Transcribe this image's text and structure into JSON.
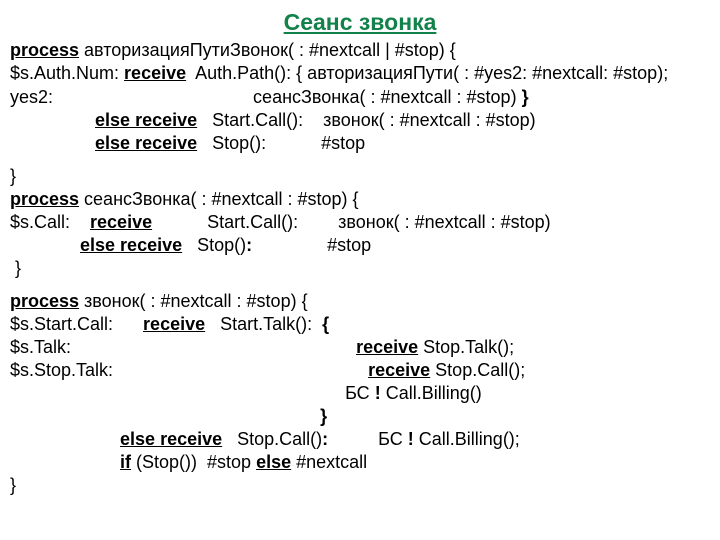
{
  "title": "Сеанс звонка",
  "block1": {
    "l1a": "process",
    "l1b": " авторизацияПутиЗвонок( : #nextcall | #stop) {",
    "l2a": "$s.Auth.Num: ",
    "l2b": "receive",
    "l2c": "  Auth.Path(): { авторизацияПути( : #yes2: #nextcall: #stop);",
    "l3": "yes2:                                        сеансЗвонка( : #nextcall : #stop) ",
    "l3b": "}",
    "l4a": "                 ",
    "l4b": "else receive",
    "l4c": "   Start.Call():    звонок( : #nextcall : #stop)",
    "l5a": "                 ",
    "l5b": "else receive",
    "l5c": "   Stop():           #stop",
    "l6": "}"
  },
  "block2": {
    "l1a": "process",
    "l1b": " сеансЗвонка( : #nextcall : #stop) {",
    "l2a": "$s.Call:    ",
    "l2b": "receive",
    "l2c": "           Start.Call():        звонок( : #nextcall : #stop)",
    "l3a": "              ",
    "l3b": "else receive",
    "l3c": "   Stop()",
    "l3d": ":",
    "l3e": "               #stop",
    "l4": " }"
  },
  "block3": {
    "l1a": "process",
    "l1b": " звонок( : #nextcall : #stop) {",
    "l2a": "$s.Start.Call:      ",
    "l2b": "receive",
    "l2c": "   Start.Talk():  ",
    "l2d": "{",
    "l3a": "$s.Talk:                                                         ",
    "l3b": "receive",
    "l3c": " Stop.Talk();",
    "l4a": "$s.Stop.Talk:                                                   ",
    "l4b": "receive",
    "l4c": " Stop.Call();",
    "l5": "                                                                   БС ",
    "l5b": "!",
    "l5c": " Call.Billing()",
    "l6": "                                                              ",
    "l6b": "}",
    "l7a": "                      ",
    "l7b": "else receive",
    "l7c": "   Stop.Call()",
    "l7d": ":",
    "l7e": "          БС ",
    "l7f": "!",
    "l7g": " Call.Billing();",
    "l8a": "                      ",
    "l8b": "if",
    "l8c": " (Stop())  #stop ",
    "l8d": "else",
    "l8e": " #nextcall",
    "l9": "}"
  }
}
